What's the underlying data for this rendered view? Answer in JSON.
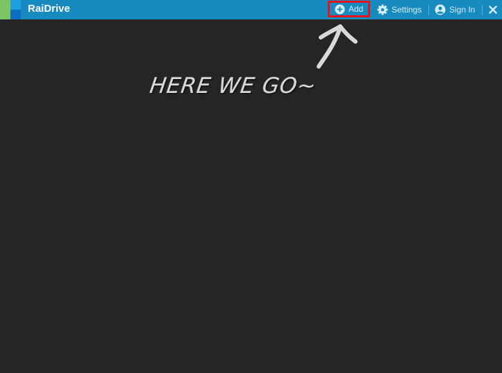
{
  "app": {
    "title": "RaiDrive"
  },
  "toolbar": {
    "add_label": "Add",
    "settings_label": "Settings",
    "signin_label": "Sign In"
  },
  "annotation": {
    "text": "HERE WE GO~"
  },
  "colors": {
    "titlebar": "#178bbf",
    "background": "#252525",
    "highlight": "#e8141b",
    "logo_green": "#7cc464",
    "logo_blue": "#1ea0e0"
  },
  "icons": {
    "logo": "raidrive-logo-icon",
    "add": "plus-circle-icon",
    "settings": "gear-icon",
    "signin": "user-circle-icon",
    "close": "close-icon",
    "annotation": "arrow-up-icon"
  }
}
